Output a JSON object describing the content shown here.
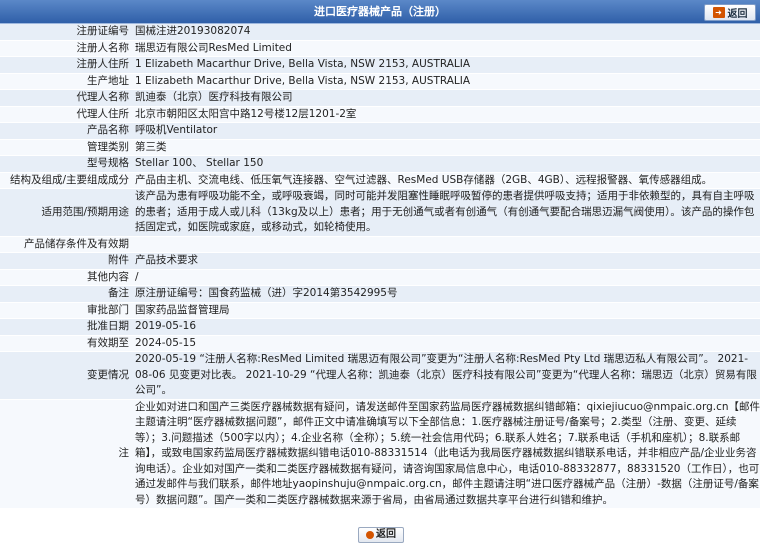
{
  "header": {
    "title": "进口医疗器械产品（注册）",
    "back_label": "返回"
  },
  "rows": [
    {
      "label": "注册证编号",
      "value": "国械注进20193082074"
    },
    {
      "label": "注册人名称",
      "value": "瑞思迈有限公司ResMed Limited"
    },
    {
      "label": "注册人住所",
      "value": "1 Elizabeth Macarthur Drive, Bella Vista, NSW 2153, AUSTRALIA"
    },
    {
      "label": "生产地址",
      "value": "1 Elizabeth Macarthur Drive, Bella Vista, NSW 2153, AUSTRALIA"
    },
    {
      "label": "代理人名称",
      "value": "凯迪泰（北京）医疗科技有限公司"
    },
    {
      "label": "代理人住所",
      "value": "北京市朝阳区太阳宫中路12号楼12层1201-2室"
    },
    {
      "label": "产品名称",
      "value": "呼吸机Ventilator"
    },
    {
      "label": "管理类别",
      "value": "第三类"
    },
    {
      "label": "型号规格",
      "value": "Stellar 100、 Stellar 150"
    },
    {
      "label": "结构及组成/主要组成成分",
      "value": "产品由主机、交流电线、低压氧气连接器、空气过滤器、ResMed USB存储器（2GB、4GB）、远程报警器、氧传感器组成。"
    },
    {
      "label": "适用范围/预期用途",
      "value": "该产品为患有呼吸功能不全，或呼吸衰竭，同时可能并发阻塞性睡眠呼吸暂停的患者提供呼吸支持；适用于非依赖型的，具有自主呼吸的患者；适用于成人或儿科（13kg及以上）患者；用于无创通气或者有创通气（有创通气要配合瑞思迈漏气阀使用）。该产品的操作包括固定式，如医院或家庭，或移动式，如轮椅使用。"
    },
    {
      "label": "产品储存条件及有效期",
      "value": ""
    },
    {
      "label": "附件",
      "value": "产品技术要求"
    },
    {
      "label": "其他内容",
      "value": "/"
    },
    {
      "label": "备注",
      "value": "原注册证编号：国食药监械（进）字2014第3542995号"
    },
    {
      "label": "审批部门",
      "value": "国家药品监督管理局"
    },
    {
      "label": "批准日期",
      "value": "2019-05-16"
    },
    {
      "label": "有效期至",
      "value": "2024-05-15"
    },
    {
      "label": "变更情况",
      "value": "2020-05-19 “注册人名称:ResMed Limited 瑞思迈有限公司”变更为“注册人名称:ResMed Pty Ltd 瑞思迈私人有限公司”。 2021-08-06 见变更对比表。 2021-10-29 “代理人名称：凯迪泰（北京）医疗科技有限公司”变更为“代理人名称：瑞思迈（北京）贸易有限公司”。"
    },
    {
      "label": "注",
      "value": "企业如对进口和国产三类医疗器械数据有疑问，请发送邮件至国家药监局医疗器械数据纠错邮箱：qixiejiucuo@nmpaic.org.cn【邮件主题请注明“医疗器械数据问题”，邮件正文中请准确填写以下全部信息：1.医疗器械注册证号/备案号；2.类型（注册、变更、延续等）；3.问题描述（500字以内）；4.企业名称（全称）；5.统一社会信用代码；6.联系人姓名；7.联系电话（手机和座机）；8.联系邮箱】，或致电国家药监局医疗器械数据纠错电话010-88331514（此电话为我局医疗器械数据纠错联系电话，并非相应产品/企业业务咨询电话）。企业如对国产一类和二类医疗器械数据有疑问，请咨询国家局信息中心，电话010-88332877，88331520（工作日），也可通过发邮件与我们联系，邮件地址yaopinshuju@nmpaic.org.cn，邮件主题请注明“进口医疗器械产品（注册）-数据（注册证号/备案号）数据问题”。国产一类和二类医疗器械数据来源于省局，由省局通过数据共享平台进行纠错和维护。"
    }
  ],
  "footer": {
    "back_label": "返回"
  }
}
